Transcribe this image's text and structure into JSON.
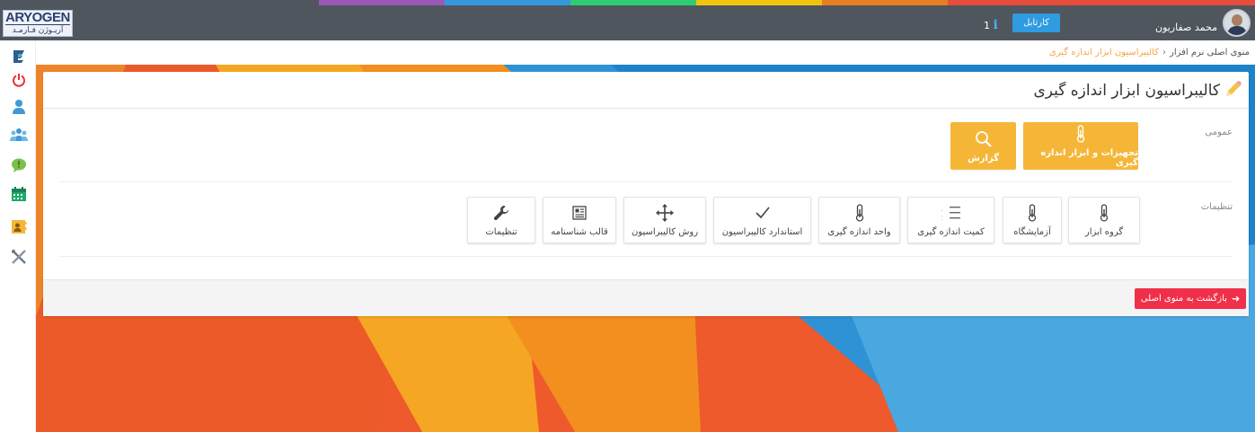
{
  "header": {
    "logo_line1": "ARYOGEN",
    "logo_line2": "آریـوژن فـارمـد",
    "user_name": "محمد صفاریون",
    "cartable_label": "کارتابل",
    "info_count": "1"
  },
  "colors": {
    "topbar": "#50565d",
    "accent_orange": "#f5b638",
    "accent_blue": "#2f9be0",
    "danger": "#f0304a"
  },
  "sidebar": {
    "items": [
      {
        "icon": "logo-e-icon"
      },
      {
        "icon": "power-icon"
      },
      {
        "icon": "user-icon"
      },
      {
        "icon": "users-icon"
      },
      {
        "icon": "message-alert-icon"
      },
      {
        "icon": "calendar-icon"
      },
      {
        "icon": "contact-card-icon"
      },
      {
        "icon": "tools-icon"
      }
    ]
  },
  "breadcrumb": {
    "home": "منوی اصلی نرم افزار",
    "current": "کالیبراسیون ابزار اندازه گیری"
  },
  "page": {
    "title": "کالیبراسیون ابزار اندازه گیری"
  },
  "sections": {
    "general": {
      "label": "عمومی",
      "tiles": [
        {
          "label": "تجهیزات و ابزار اندازه گیری",
          "icon": "thermometer-icon"
        },
        {
          "label": "گزارش",
          "icon": "search-icon"
        }
      ]
    },
    "settings": {
      "label": "تنظیمات",
      "tiles": [
        {
          "label": "گروه ابزار",
          "icon": "thermometer-icon"
        },
        {
          "label": "آزمایشگاه",
          "icon": "thermometer-icon"
        },
        {
          "label": "کمیت اندازه گیری",
          "icon": "numbered-list-icon"
        },
        {
          "label": "واحد اندازه گیری",
          "icon": "thermometer-icon"
        },
        {
          "label": "استاندارد کالیبراسیون",
          "icon": "check-icon"
        },
        {
          "label": "روش کالیبراسیون",
          "icon": "move-arrows-icon"
        },
        {
          "label": "قالب شناسنامه",
          "icon": "newspaper-icon"
        },
        {
          "label": "تنظیمات",
          "icon": "wrench-icon"
        }
      ]
    }
  },
  "footer": {
    "back_label": "بازگشت به منوی اصلی"
  }
}
